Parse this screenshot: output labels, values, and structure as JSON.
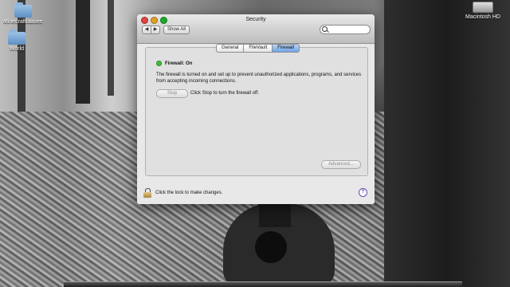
{
  "desktop": {
    "icons": [
      {
        "label": "Minecraftlaasee",
        "kind": "folder"
      },
      {
        "label": "World",
        "kind": "folder"
      },
      {
        "label": "Macintosh HD",
        "kind": "drive"
      }
    ]
  },
  "window": {
    "title": "Security",
    "nav_back_glyph": "◀",
    "nav_forward_glyph": "▶",
    "show_all": "Show All",
    "search_placeholder": "",
    "tabs": [
      {
        "label": "General",
        "active": false
      },
      {
        "label": "FileVault",
        "active": false
      },
      {
        "label": "Firewall",
        "active": true
      }
    ],
    "firewall": {
      "status": "Firewall: On",
      "status_color": "#3fbe3a",
      "description": "The firewall is turned on and set up to prevent unauthorized applications, programs, and services from accepting incoming connections.",
      "stop_button": "Stop",
      "stop_hint": "Click Stop to turn the firewall off.",
      "advanced_button": "Advanced..."
    },
    "lock_text": "Click the lock to make changes.",
    "help_glyph": "?"
  },
  "icons": {
    "lock": "lock-icon",
    "search": "search-icon",
    "help": "help-icon"
  }
}
